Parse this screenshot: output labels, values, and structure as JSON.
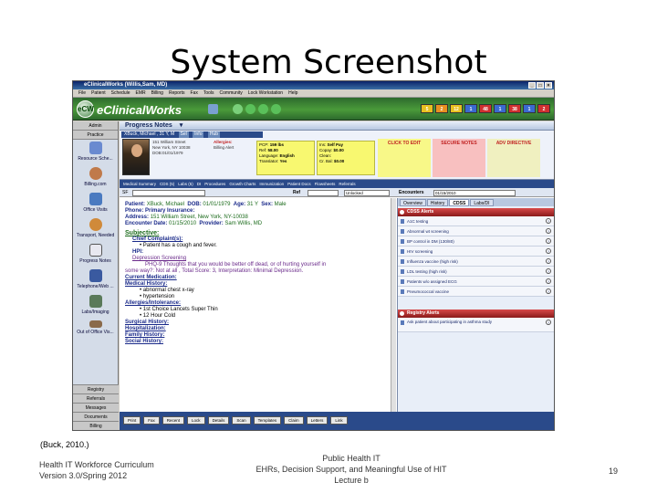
{
  "slide": {
    "title": "System Screenshot",
    "caption": "(Buck, 2010.)",
    "footer_left": [
      "Health IT Workforce Curriculum",
      "Version 3.0/Spring 2012"
    ],
    "footer_center": [
      "Public Health IT",
      "EHRs, Decision Support, and Meaningful Use of HIT",
      "Lecture b"
    ],
    "page_number": "19"
  },
  "app": {
    "window_title": "eClinicalWorks (Willis,Sam, MD)",
    "menu": [
      "File",
      "Patient",
      "Schedule",
      "EMR",
      "Billing",
      "Reports",
      "Fax",
      "Tools",
      "Community",
      "Lock Workstation",
      "Help"
    ],
    "brand": "eClinicalWorks",
    "logo_text": "eCW",
    "toolbar_badges": [
      "5",
      "2",
      "12",
      "1",
      "48",
      "1",
      "38",
      "1",
      "2"
    ],
    "colors": {
      "brand_green": "#3a7a2a",
      "nav_blue": "#2a4a8a",
      "alert_red": "#b02020",
      "note_yellow": "#f8f870"
    }
  },
  "leftnav": {
    "top_tabs": [
      "Admin",
      "Practice"
    ],
    "items": [
      "Resource Sche...",
      "Billing.com",
      "Office Visits",
      "Transport, Needed",
      "Progress Notes",
      "Telephone/Web ...",
      "Labs/Imaging",
      "Out of Office Vis..."
    ],
    "bottom_tabs": [
      "Registry",
      "Referrals",
      "Messages",
      "Documents",
      "Billing"
    ]
  },
  "progress_notes": {
    "header": "Progress Notes",
    "patient_bar_name": "XBuck, Michael , 31 Y, M",
    "patient_bar_chips": [
      "Sel",
      "Info",
      "Hub"
    ],
    "address_lines": [
      "151 William Street",
      "New York, NY 10038",
      "DOB:01/01/1979"
    ],
    "allergies_lines": [
      "Allergies:",
      "Billing Alert"
    ],
    "box1_lines": [
      "PCP:",
      "Ref:",
      "Language:",
      "Translator:"
    ],
    "box1_values": [
      "159 lbs",
      "58.00",
      "English",
      "Yes"
    ],
    "box2_lines": [
      "Ins:",
      "Copay:",
      "Clean:",
      "Cr. Bal:"
    ],
    "box2_values": [
      "Self Pay",
      "$0.00",
      "",
      "$0.00"
    ],
    "cards": [
      "CLICK TO EDIT",
      "SECURE NOTES",
      "ADV DIRECTIVE"
    ],
    "tabs": [
      "Medical Summary",
      "CDS (5)",
      "Labs (5)",
      "DI",
      "Procedures",
      "Growth Charts",
      "Immunization",
      "Patient Docs",
      "Flowsheets",
      "Referrals"
    ],
    "filter": {
      "sf_label": "SF",
      "ref_label": "Ref",
      "status_value": "Unlocked",
      "encounters_label": "Encounters",
      "encounter_date": "01/15/2010"
    }
  },
  "note": {
    "patient_label": "Patient:",
    "patient_name": "XBuck, Michael",
    "dob_label": "DOB:",
    "dob": "01/01/1979",
    "age_label": "Age:",
    "age": "31 Y",
    "sex_label": "Sex:",
    "sex": "Male",
    "phone_label": "Phone:",
    "phone": "Primary Insurance:",
    "address_label": "Address:",
    "address": "151 William Street, New York, NY-10038",
    "enc_label": "Encounter Date:",
    "enc_date": "01/15/2010",
    "provider_label": "Provider:",
    "provider": "Sam Willis, MD",
    "subjective": "Subjective:",
    "chief_complaint": "Chief Complaint(s):",
    "complaint_text": "Patient has a cough and fever.",
    "hpi": "HPI:",
    "depression": "Depression Screening",
    "phq_text": "PHQ-9  Thoughts that you would be better off dead, or of hurting yourself in",
    "phq_text2": "some way?: Not at all , Total Score: 3, Interpretation: Minimal Depression.",
    "current_medication": "Current Medication:",
    "medical_history": "Medical History:",
    "mh_items": [
      "abnormal chest x-ray",
      "hypertension"
    ],
    "allergies_intolerance": "Allergies/Intolerance:",
    "ai_items": [
      "1st Choice Lancets Super Thin",
      "12 Hour Cold"
    ],
    "surgical": "Surgical History:",
    "hospitalization": "Hospitalization:",
    "family": "Family History:",
    "social": "Social History:"
  },
  "right_panel": {
    "tabs": [
      "Overview",
      "History",
      "CDSS",
      "Labs/DI"
    ],
    "active_tab": "CDSS",
    "cdss_header": "CDSS Alerts",
    "cdss_items": [
      "A1C testing",
      "Abnormal wt screening",
      "BP control in DM (130/80)",
      "HIV screening",
      "Influenza vaccine (high risk)",
      "LDL testing (high risk)",
      "Patients w/o assigned ECG",
      "Pneumococcal vaccine"
    ],
    "registry_header": "Registry Alerts",
    "registry_items": [
      "Ask patient about participating in asthma study"
    ]
  },
  "buttons": [
    "Print",
    "Fax",
    "Recent",
    "Lock",
    "Details",
    "Scan",
    "Templates",
    "Claim",
    "Letters",
    "Link"
  ]
}
